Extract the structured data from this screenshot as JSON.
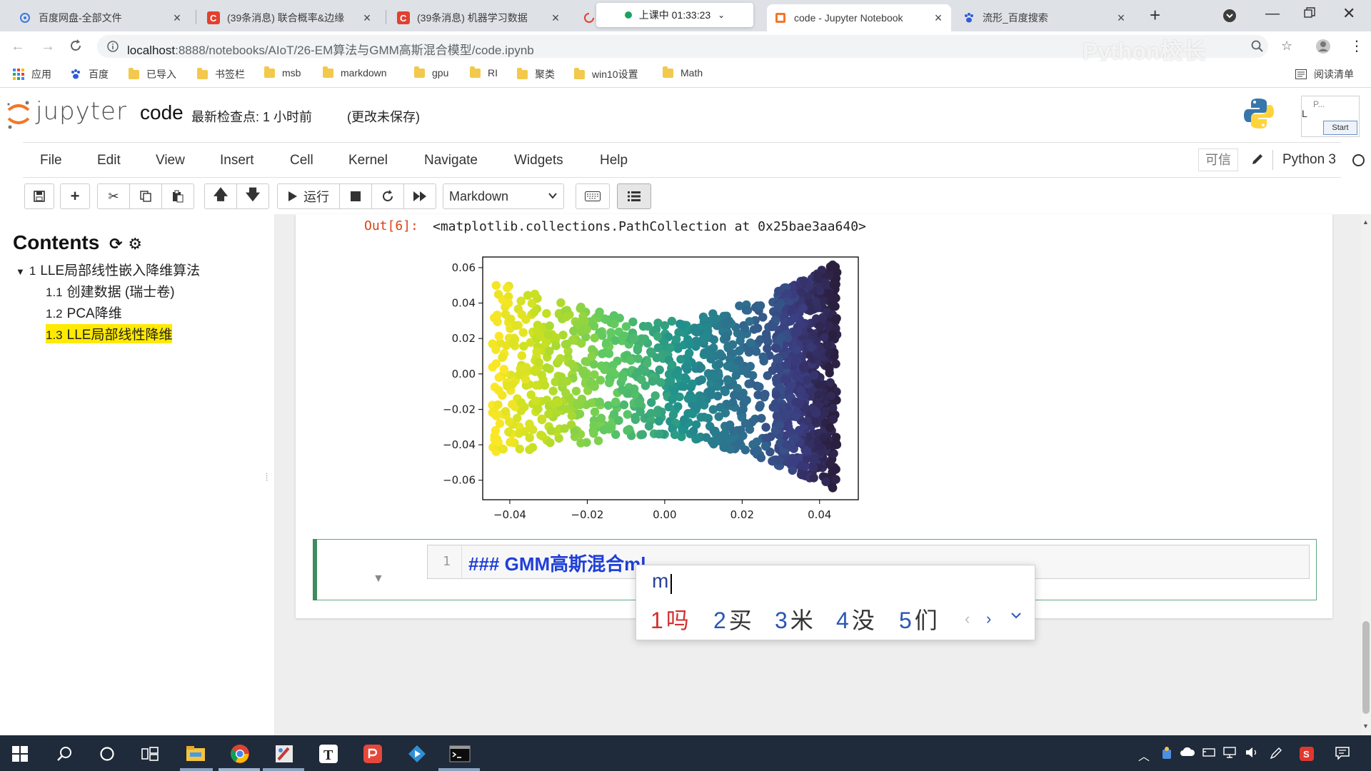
{
  "browser": {
    "tabs": [
      {
        "title": "百度网盘-全部文件",
        "close": "×"
      },
      {
        "title": "(39条消息) 联合概率&边缘",
        "close": "×"
      },
      {
        "title": "(39条消息) 机器学习数据",
        "close": "×"
      },
      {
        "title": "上课中 01:33:23",
        "close": ""
      },
      {
        "title": "code - Jupyter Notebook",
        "close": "×"
      },
      {
        "title": "流形_百度搜索",
        "close": "×"
      }
    ],
    "new_tab": "+",
    "url_host": "localhost",
    "url_rest": ":8888/notebooks/AIoT/26-EM算法与GMM高斯混合模型/code.ipynb",
    "watermark": "Python校长",
    "bookmarks": [
      "应用",
      "百度",
      "已导入",
      "书签栏",
      "msb",
      "markdown",
      "gpu",
      "RI",
      "聚类",
      "win10设置",
      "Math"
    ],
    "reading_list": "阅读清单",
    "extension_label": "P...",
    "extension_button": "Start"
  },
  "jupyter": {
    "logo": "jupyter",
    "notebook_name": "code",
    "checkpoint": "最新检查点: 1 小时前",
    "autosave": "(更改未保存)",
    "menu": [
      "File",
      "Edit",
      "View",
      "Insert",
      "Cell",
      "Kernel",
      "Navigate",
      "Widgets",
      "Help"
    ],
    "trusted": "可信",
    "kernel": "Python 3",
    "toolbar": {
      "run_label": "运行",
      "cell_type": "Markdown"
    }
  },
  "toc": {
    "title": "Contents",
    "items": [
      {
        "num": "1",
        "label": "LLE局部线性嵌入降维算法"
      },
      {
        "num": "1.1",
        "label": "创建数据 (瑞士卷)"
      },
      {
        "num": "1.2",
        "label": "PCA降维"
      },
      {
        "num": "1.3",
        "label": "LLE局部线性降维"
      }
    ]
  },
  "output": {
    "prompt": "Out[6]:",
    "text": "<matplotlib.collections.PathCollection at 0x25bae3aa640>"
  },
  "chart_data": {
    "type": "scatter",
    "title": "",
    "xlabel": "",
    "ylabel": "",
    "xlim": [
      -0.047,
      0.05
    ],
    "ylim": [
      -0.071,
      0.066
    ],
    "xticks": [
      "−0.04",
      "−0.02",
      "0.00",
      "0.02",
      "0.04"
    ],
    "xtick_values": [
      -0.04,
      -0.02,
      0.0,
      0.02,
      0.04
    ],
    "yticks": [
      "0.06",
      "0.04",
      "0.02",
      "0.00",
      "−0.02",
      "−0.04",
      "−0.06"
    ],
    "ytick_values": [
      0.06,
      0.04,
      0.02,
      0.0,
      -0.02,
      -0.04,
      -0.06
    ],
    "grid": false,
    "colormap": "viridis",
    "colors": {
      "low": "#fde725",
      "mid": "#21918c",
      "high": "#2b1f3f"
    },
    "shape": {
      "x_range": [
        -0.0445,
        0.0445
      ],
      "top_left": 0.052,
      "top_mid": 0.029,
      "top_right": 0.063,
      "bottom_left": -0.046,
      "bottom_mid": -0.034,
      "bottom_right": -0.066,
      "approx_points": 1500
    }
  },
  "cell": {
    "line_number": "1",
    "code": "### GMM高斯混合ml"
  },
  "ime": {
    "input": "m",
    "candidates": [
      {
        "n": "1",
        "w": "吗"
      },
      {
        "n": "2",
        "w": "买"
      },
      {
        "n": "3",
        "w": "米"
      },
      {
        "n": "4",
        "w": "没"
      },
      {
        "n": "5",
        "w": "们"
      }
    ]
  }
}
